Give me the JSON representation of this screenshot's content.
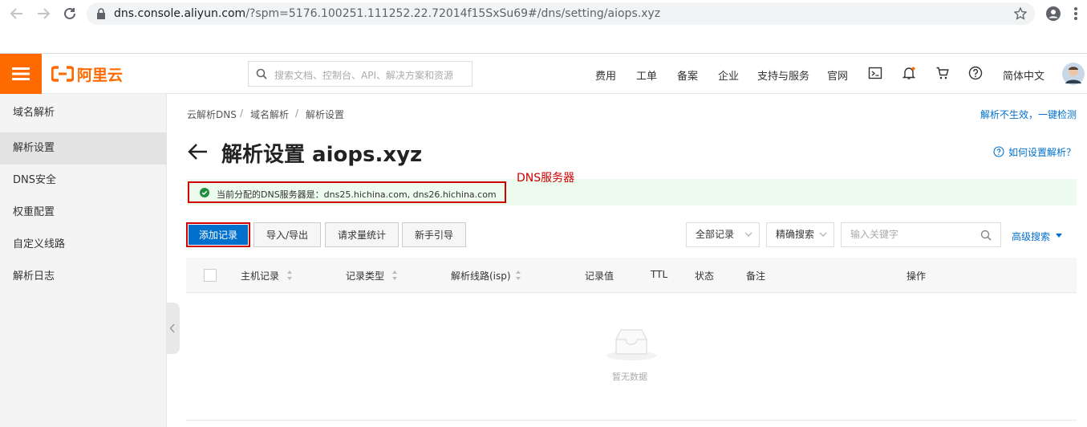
{
  "browser": {
    "url_host": "dns.console.aliyun.com",
    "url_rest": "/?spm=5176.100251.111252.22.72014f15SxSu69#/dns/setting/aiops.xyz"
  },
  "header": {
    "logo_text": "阿里云",
    "search_placeholder": "搜索文档、控制台、API、解决方案和资源",
    "nav": [
      "费用",
      "工单",
      "备案",
      "企业",
      "支持与服务",
      "官网"
    ],
    "language": "简体中文",
    "accent_color": "#ff6a00"
  },
  "sidebar": {
    "items": [
      {
        "label": "域名解析",
        "active": false
      },
      {
        "label": "解析设置",
        "active": true
      },
      {
        "label": "DNS安全",
        "active": false
      },
      {
        "label": "权重配置",
        "active": false
      },
      {
        "label": "自定义线路",
        "active": false
      },
      {
        "label": "解析日志",
        "active": false
      }
    ]
  },
  "breadcrumb": [
    "云解析DNS",
    "域名解析",
    "解析设置"
  ],
  "top_right_link": "解析不生效，一键检测",
  "page_title": "解析设置 aiops.xyz",
  "help_link": "如何设置解析？",
  "dns_notice": "当前分配的DNS服务器是：dns25.hichina.com, dns26.hichina.com",
  "annotation": "DNS服务器",
  "toolbar": {
    "buttons": [
      "添加记录",
      "导入/导出",
      "请求量统计",
      "新手引导"
    ],
    "record_filter": "全部记录",
    "search_mode": "精确搜索",
    "keyword_placeholder": "输入关键字",
    "advanced_search": "高级搜索"
  },
  "table": {
    "columns": [
      "主机记录",
      "记录类型",
      "解析线路(isp)",
      "记录值",
      "TTL",
      "状态",
      "备注",
      "操作"
    ],
    "empty_text": "暂无数据"
  }
}
